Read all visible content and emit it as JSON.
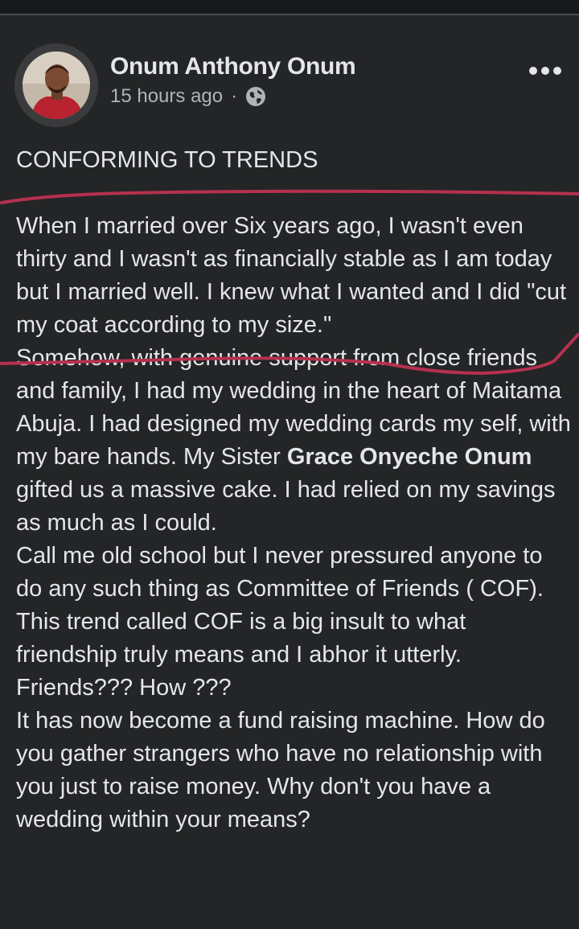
{
  "post": {
    "author": "Onum Anthony Onum",
    "time": "15 hours ago",
    "separator": "·",
    "privacy_icon": "globe-icon",
    "more_icon": "more-options-icon",
    "title": "CONFORMING TO TRENDS",
    "paragraph1": "When I married over Six years ago, I wasn't even thirty and I wasn't as financially stable as I am today but I married well.  I knew what I wanted and I did \"cut my coat according to my size.\"",
    "paragraph2_before": "Somehow, with genuine support from close friends and family, I had my wedding in the heart of Maitama Abuja. I had designed my wedding cards my self, with my bare hands. My Sister ",
    "mention": "Grace Onyeche Onum",
    "paragraph2_after": "  gifted us a massive cake. I had relied on my savings as much as I could.",
    "paragraph3": "Call me old school but I never pressured anyone to do any such thing as Committee of Friends ( COF). This trend called COF is a big insult to what friendship truly means and I abhor it utterly. Friends??? How ???",
    "paragraph4": "It has now become a fund raising machine. How do you gather strangers who have no relationship with you just to raise money. Why don't you have a wedding within your means?"
  },
  "colors": {
    "background": "#242526",
    "text": "#e4e6eb",
    "secondary_text": "#b0b3b8",
    "annotation": "#b5314f"
  }
}
